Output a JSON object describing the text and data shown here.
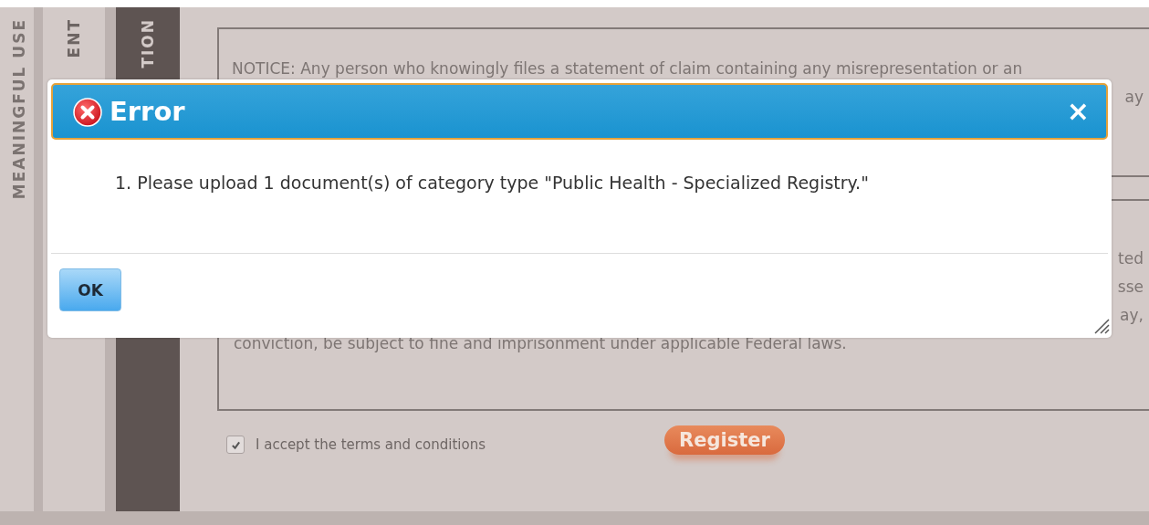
{
  "side_tabs": [
    {
      "label": "MEANINGFUL USE",
      "selected": false
    },
    {
      "label": "ENT",
      "selected": false
    },
    {
      "label": "TION",
      "selected": true
    }
  ],
  "notice_box": {
    "lines": [
      {
        "kind": "full",
        "text": "NOTICE: Any person who knowingly files a statement of claim containing any misrepresentation or an"
      },
      {
        "kind": "tail",
        "text": "ay"
      }
    ]
  },
  "attestation_box": {
    "lines": [
      {
        "kind": "tail",
        "text": "ted"
      },
      {
        "kind": "tail",
        "text": "sse"
      },
      {
        "kind": "tail",
        "text": "ay,"
      },
      {
        "kind": "full",
        "text": "conviction, be subject to fine and imprisonment under applicable Federal laws."
      }
    ]
  },
  "terms": {
    "label": "I accept the terms and conditions",
    "checked": true
  },
  "register_button": "Register",
  "dialog": {
    "title": "Error",
    "close": "×",
    "messages": [
      "1. Please upload 1 document(s) of category type \"Public Health - Specialized Registry.\""
    ],
    "ok_button": "OK"
  }
}
